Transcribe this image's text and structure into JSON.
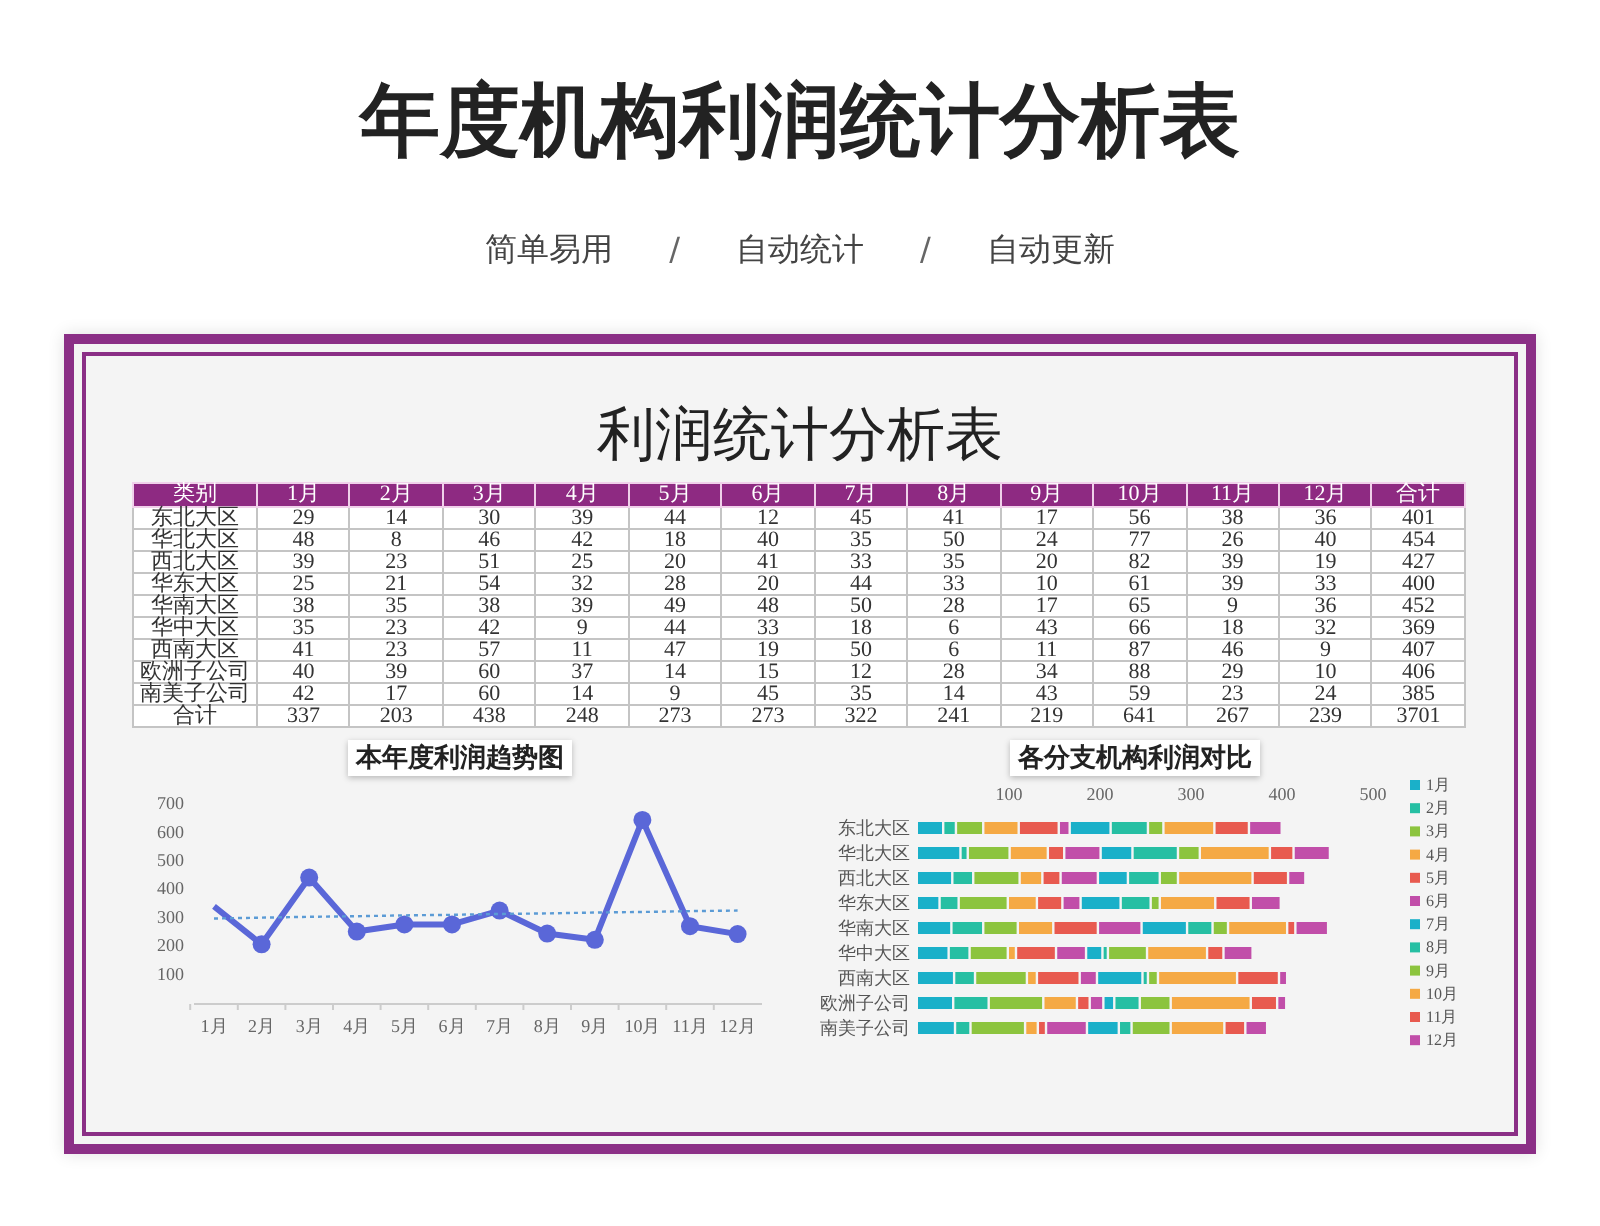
{
  "header": {
    "title": "年度机构利润统计分析表",
    "subtitle": [
      {
        "kind": "label",
        "text": "简单易用"
      },
      {
        "kind": "separator",
        "text": "/"
      },
      {
        "kind": "label",
        "text": "自动统计"
      },
      {
        "kind": "separator",
        "text": "/"
      },
      {
        "kind": "label",
        "text": "自动更新"
      }
    ]
  },
  "report": {
    "title": "利润统计分析表",
    "table": {
      "columns": [
        "类别",
        "1月",
        "2月",
        "3月",
        "4月",
        "5月",
        "6月",
        "7月",
        "8月",
        "9月",
        "10月",
        "11月",
        "12月",
        "合计"
      ],
      "rows": [
        [
          "东北大区",
          "29",
          "14",
          "30",
          "39",
          "44",
          "12",
          "45",
          "41",
          "17",
          "56",
          "38",
          "36",
          "401"
        ],
        [
          "华北大区",
          "48",
          "8",
          "46",
          "42",
          "18",
          "40",
          "35",
          "50",
          "24",
          "77",
          "26",
          "40",
          "454"
        ],
        [
          "西北大区",
          "39",
          "23",
          "51",
          "25",
          "20",
          "41",
          "33",
          "35",
          "20",
          "82",
          "39",
          "19",
          "427"
        ],
        [
          "华东大区",
          "25",
          "21",
          "54",
          "32",
          "28",
          "20",
          "44",
          "33",
          "10",
          "61",
          "39",
          "33",
          "400"
        ],
        [
          "华南大区",
          "38",
          "35",
          "38",
          "39",
          "49",
          "48",
          "50",
          "28",
          "17",
          "65",
          "9",
          "36",
          "452"
        ],
        [
          "华中大区",
          "35",
          "23",
          "42",
          "9",
          "44",
          "33",
          "18",
          "6",
          "43",
          "66",
          "18",
          "32",
          "369"
        ],
        [
          "西南大区",
          "41",
          "23",
          "57",
          "11",
          "47",
          "19",
          "50",
          "6",
          "11",
          "87",
          "46",
          "9",
          "407"
        ],
        [
          "欧洲子公司",
          "40",
          "39",
          "60",
          "37",
          "14",
          "15",
          "12",
          "28",
          "34",
          "88",
          "29",
          "10",
          "406"
        ],
        [
          "南美子公司",
          "42",
          "17",
          "60",
          "14",
          "9",
          "45",
          "35",
          "14",
          "43",
          "59",
          "23",
          "24",
          "385"
        ],
        [
          "合计",
          "337",
          "203",
          "438",
          "248",
          "273",
          "273",
          "322",
          "241",
          "219",
          "641",
          "267",
          "239",
          "3701"
        ]
      ]
    },
    "trend_chart": {
      "chart_data": {
        "type": "line",
        "title": "本年度利润趋势图",
        "categories": [
          "1月",
          "2月",
          "3月",
          "4月",
          "5月",
          "6月",
          "7月",
          "8月",
          "9月",
          "10月",
          "11月",
          "12月"
        ],
        "series": [
          {
            "color": "#5a67d8",
            "marker": "circle",
            "values": [
              337,
              203,
              438,
              248,
              273,
              273,
              322,
              241,
              219,
              641,
              267,
              239
            ]
          },
          {
            "color": "#5b9bd5",
            "line_style": "dotted",
            "values": [
              294,
              297,
              300,
              302,
              305,
              307,
              310,
              312,
              315,
              317,
              320,
              322
            ]
          }
        ],
        "ylim": [
          0,
          700
        ],
        "yticks": [
          {
            "value": 100,
            "label": "100"
          },
          {
            "value": 200,
            "label": "200"
          },
          {
            "value": 300,
            "label": "300"
          },
          {
            "value": 400,
            "label": "400"
          },
          {
            "value": 500,
            "label": "500"
          },
          {
            "value": 600,
            "label": "600"
          },
          {
            "value": 700,
            "label": "700"
          }
        ]
      }
    },
    "comparison_chart": {
      "chart_data": {
        "type": "bar",
        "orientation": "horizontal",
        "stacked": true,
        "title": "各分支机构利润对比",
        "categories": [
          "东北大区",
          "华北大区",
          "西北大区",
          "华东大区",
          "华南大区",
          "华中大区",
          "西南大区",
          "欧洲子公司",
          "南美子公司"
        ],
        "series": [
          {
            "name": "1月",
            "color": "#1ab0c9",
            "values": [
              29,
              48,
              39,
              25,
              38,
              35,
              41,
              40,
              42
            ]
          },
          {
            "name": "2月",
            "color": "#26bfa3",
            "values": [
              14,
              8,
              23,
              21,
              35,
              23,
              23,
              39,
              17
            ]
          },
          {
            "name": "3月",
            "color": "#8cc43e",
            "values": [
              30,
              46,
              51,
              54,
              38,
              42,
              57,
              60,
              60
            ]
          },
          {
            "name": "4月",
            "color": "#f5a944",
            "values": [
              39,
              42,
              25,
              32,
              39,
              9,
              11,
              37,
              14
            ]
          },
          {
            "name": "5月",
            "color": "#e85a4f",
            "values": [
              44,
              18,
              20,
              28,
              49,
              44,
              47,
              14,
              9
            ]
          },
          {
            "name": "6月",
            "color": "#c14ea9",
            "values": [
              12,
              40,
              41,
              20,
              48,
              33,
              19,
              15,
              45
            ]
          },
          {
            "name": "7月",
            "color": "#1ab0c9",
            "values": [
              45,
              35,
              33,
              44,
              50,
              18,
              50,
              12,
              35
            ]
          },
          {
            "name": "8月",
            "color": "#26bfa3",
            "values": [
              41,
              50,
              35,
              33,
              28,
              6,
              6,
              28,
              14
            ]
          },
          {
            "name": "9月",
            "color": "#8cc43e",
            "values": [
              17,
              24,
              20,
              10,
              17,
              43,
              11,
              34,
              43
            ]
          },
          {
            "name": "10月",
            "color": "#f5a944",
            "values": [
              56,
              77,
              82,
              61,
              65,
              66,
              87,
              88,
              59
            ]
          },
          {
            "name": "11月",
            "color": "#e85a4f",
            "values": [
              38,
              26,
              39,
              39,
              9,
              18,
              46,
              29,
              23
            ]
          },
          {
            "name": "12月",
            "color": "#c14ea9",
            "values": [
              36,
              40,
              19,
              33,
              36,
              32,
              9,
              10,
              24
            ]
          }
        ],
        "xlim": [
          0,
          500
        ],
        "xticks": [
          {
            "value": 100,
            "label": "100"
          },
          {
            "value": 200,
            "label": "200"
          },
          {
            "value": 300,
            "label": "300"
          },
          {
            "value": 400,
            "label": "400"
          },
          {
            "value": 500,
            "label": "500"
          }
        ],
        "legend": "right"
      }
    }
  }
}
